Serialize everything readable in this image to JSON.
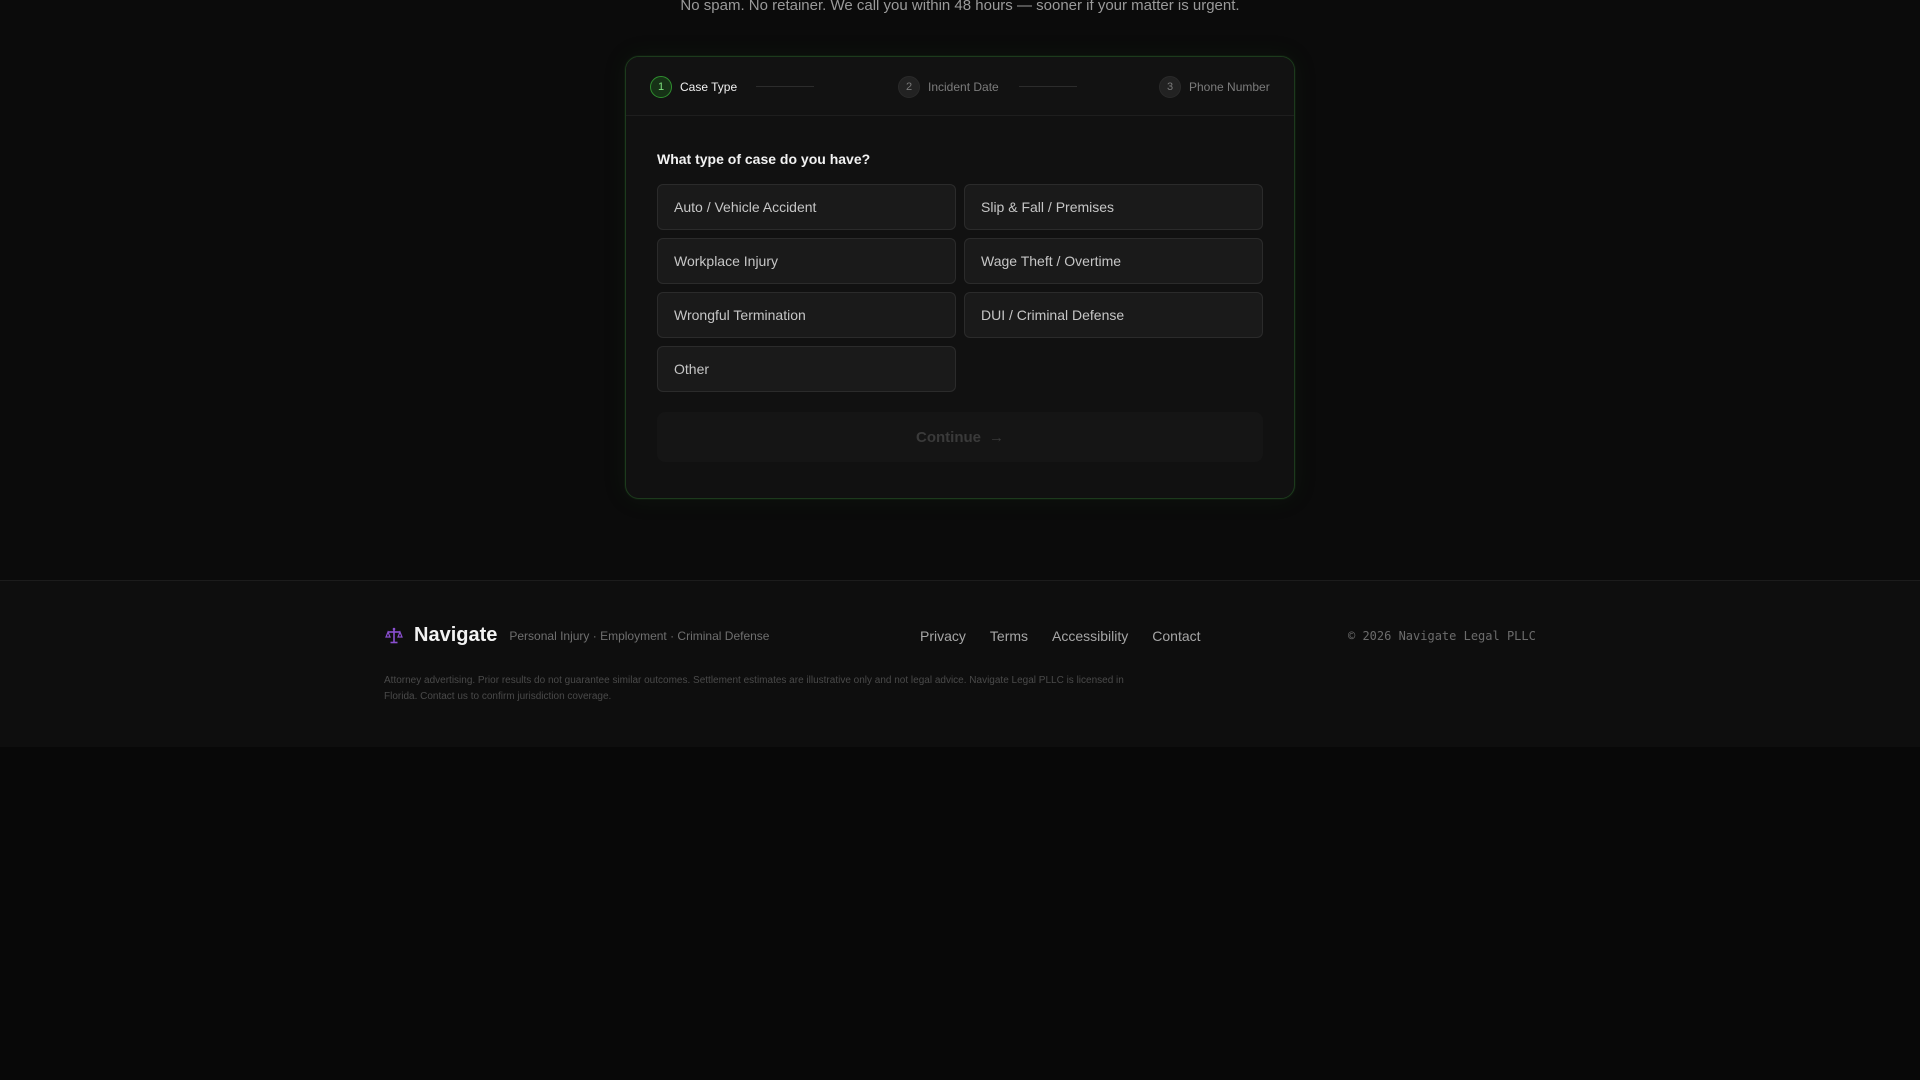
{
  "intro": {
    "subtitle": "No spam. No retainer. We call you within 48 hours — sooner if your matter is urgent."
  },
  "stepper": {
    "steps": [
      {
        "number": "1",
        "label": "Case Type",
        "state": "active"
      },
      {
        "number": "2",
        "label": "Incident Date",
        "state": "inactive"
      },
      {
        "number": "3",
        "label": "Phone Number",
        "state": "inactive"
      }
    ]
  },
  "form": {
    "question": "What type of case do you have?",
    "options": [
      "Auto / Vehicle Accident",
      "Slip & Fall / Premises",
      "Workplace Injury",
      "Wage Theft / Overtime",
      "Wrongful Termination",
      "DUI / Criminal Defense",
      "Other"
    ],
    "continue_label": "Continue",
    "continue_arrow": "→"
  },
  "footer": {
    "brand_name": "Navigate",
    "tagline": "Personal Injury · Employment · Criminal Defense",
    "nav": [
      "Privacy",
      "Terms",
      "Accessibility",
      "Contact"
    ],
    "copyright": "© 2026 Navigate Legal PLLC",
    "disclaimer": "Attorney advertising. Prior results do not guarantee similar outcomes. Settlement estimates are illustrative only and not legal advice. Navigate Legal PLLC is licensed in Florida. Contact us to confirm jurisdiction coverage."
  },
  "icons": {
    "brand": "scales-of-justice-icon",
    "continue": "arrow-right-icon"
  },
  "colors": {
    "accent": "#2f8f2f",
    "accent_text": "#7ee07e",
    "background": "#0b0b0b",
    "card": "#111111",
    "brand_icon": "#8a4fd0"
  }
}
